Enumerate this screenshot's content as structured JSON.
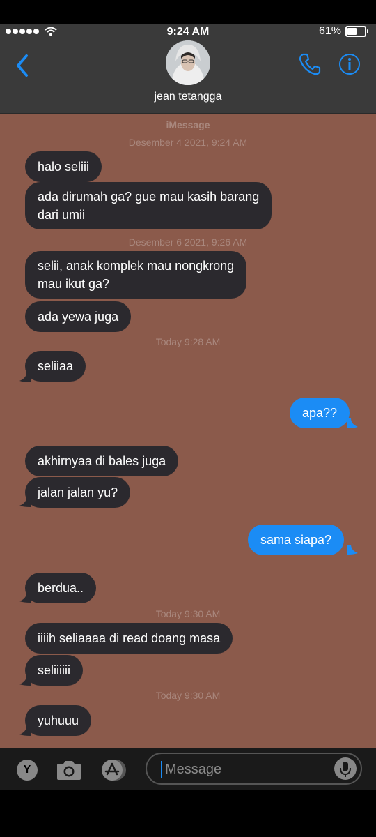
{
  "status": {
    "time": "9:24 AM",
    "battery": "61%",
    "battery_level": 0.61
  },
  "header": {
    "contact_name": "jean tetangga"
  },
  "thread": {
    "service": "iMessage",
    "dates": [
      "Desember 4 2021, 9:24 AM",
      "Desember 6 2021, 9:26 AM",
      "Today 9:28 AM",
      "Today 9:30 AM",
      "Today 9:30 AM"
    ],
    "messages": [
      {
        "text": "halo seliii",
        "dir": "in"
      },
      {
        "text": "ada dirumah ga? gue mau kasih barang",
        "text2": "dari umii",
        "dir": "in"
      },
      {
        "text": "selii, anak komplek mau nongkrong",
        "text2": "mau ikut ga?",
        "dir": "in"
      },
      {
        "text": "ada yewa juga",
        "dir": "in"
      },
      {
        "text": "seliiaa",
        "dir": "in"
      },
      {
        "text": "apa??",
        "dir": "out"
      },
      {
        "text": "akhirnyaa di bales juga",
        "dir": "in"
      },
      {
        "text": "jalan jalan yu?",
        "dir": "in"
      },
      {
        "text": "sama siapa?",
        "dir": "out"
      },
      {
        "text": "berdua..",
        "dir": "in"
      },
      {
        "text": "iiiih seliaaaa di read doang masa",
        "dir": "in"
      },
      {
        "text": "seliiiiii",
        "dir": "in"
      },
      {
        "text": "yuhuuu",
        "dir": "in"
      }
    ]
  },
  "composer": {
    "placeholder": "Message",
    "y_button": "Y"
  },
  "icons": [
    "back-chevron-icon",
    "phone-icon",
    "info-icon",
    "camera-icon",
    "app-store-icon",
    "microphone-icon",
    "wifi-icon"
  ],
  "colors": {
    "accent": "#1b8cf5",
    "incoming": "#2b292e",
    "background": "#8b5a4b"
  }
}
